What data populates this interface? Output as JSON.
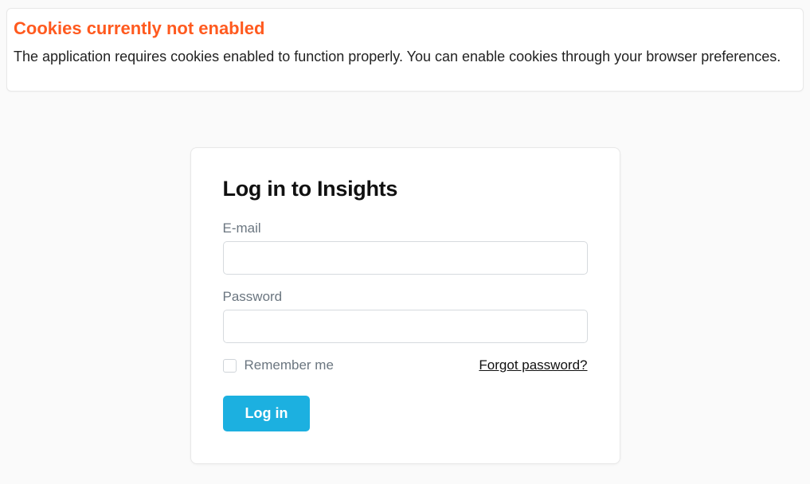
{
  "alert": {
    "title": "Cookies currently not enabled",
    "message": "The application requires cookies enabled to function properly. You can enable cookies through your browser preferences."
  },
  "login": {
    "title": "Log in to Insights",
    "email_label": "E-mail",
    "email_value": "",
    "password_label": "Password",
    "password_value": "",
    "remember_label": "Remember me",
    "forgot_label": "Forgot password?",
    "submit_label": "Log in"
  }
}
